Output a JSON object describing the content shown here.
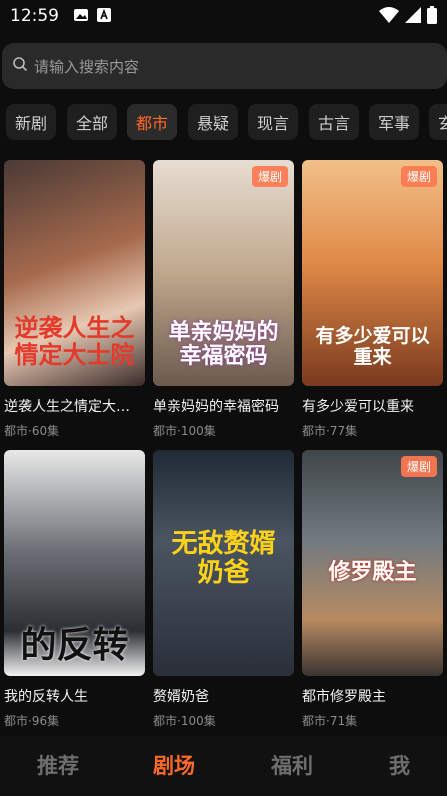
{
  "status": {
    "time": "12:59"
  },
  "search": {
    "placeholder": "请输入搜索内容"
  },
  "tags": [
    "新剧",
    "全部",
    "都市",
    "悬疑",
    "现言",
    "古言",
    "军事",
    "玄"
  ],
  "active_tag": "都市",
  "cards": [
    {
      "title": "逆袭人生之情定大…",
      "meta": "都市·60集",
      "badge": "",
      "poster_text": "逆袭人生之情定大士院",
      "bg": "#7a5a4a"
    },
    {
      "title": "单亲妈妈的幸福密码",
      "meta": "都市·100集",
      "badge": "爆剧",
      "poster_text": "单亲妈妈的幸福密码",
      "bg": "#b39a7f"
    },
    {
      "title": "有多少爱可以重来",
      "meta": "都市·77集",
      "badge": "爆剧",
      "poster_text": "有多少爱可以重来",
      "bg": "#c87b47"
    },
    {
      "title": "我的反转人生",
      "meta": "都市·96集",
      "badge": "",
      "poster_text": "的反转",
      "bg": "#5a5f66"
    },
    {
      "title": "赘婿奶爸",
      "meta": "都市·100集",
      "badge": "",
      "poster_text": "无敌赘婿奶爸",
      "bg": "#39424c"
    },
    {
      "title": "都市修罗殿主",
      "meta": "都市·71集",
      "badge": "爆剧",
      "poster_text": "修罗殿主",
      "bg": "#5a6063"
    }
  ],
  "nav": [
    "推荐",
    "剧场",
    "福利",
    "我"
  ],
  "active_nav": "剧场",
  "colors": {
    "accent": "#ff6a2b",
    "badge": "#ff7850"
  }
}
